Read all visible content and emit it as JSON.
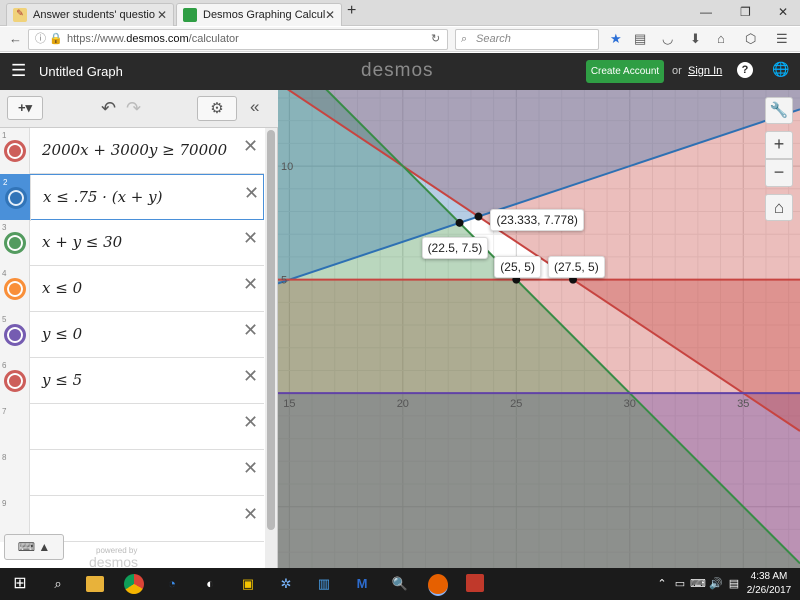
{
  "browser": {
    "tabs": [
      {
        "title": "Answer students' question…",
        "close": "✕"
      },
      {
        "title": "Desmos Graphing Calcula…",
        "close": "✕"
      }
    ],
    "new_tab": "+",
    "window_controls": [
      "—",
      "❐",
      "✕"
    ],
    "url_prefix": "https://www.",
    "url_domain": "desmos.com",
    "url_path": "/calculator",
    "search_placeholder": "Search",
    "reload": "↻"
  },
  "desmos": {
    "menu_icon": "☰",
    "graph_title": "Untitled Graph",
    "logo": "desmos",
    "create_account": "Create Account",
    "or": "or",
    "sign_in": "Sign In",
    "help": "?",
    "globe": "🌐"
  },
  "expression_toolbar": {
    "add": "+▾",
    "undo": "↶",
    "redo": "↷",
    "settings": "⚙",
    "collapse": "«"
  },
  "expressions": [
    {
      "num": "1",
      "text": "2000x + 3000y ≥ 70000",
      "color": "#c74440"
    },
    {
      "num": "2",
      "text": "x ≤ .75 · (x + y)",
      "color": "#2d70b3"
    },
    {
      "num": "3",
      "text": "x + y ≤ 30",
      "color": "#388c46"
    },
    {
      "num": "4",
      "text": "x ≤ 0",
      "color": "#fa7e19"
    },
    {
      "num": "5",
      "text": "y ≤ 0",
      "color": "#6042a6"
    },
    {
      "num": "6",
      "text": "y ≤ 5",
      "color": "#c74440"
    },
    {
      "num": "7",
      "text": "",
      "color": ""
    },
    {
      "num": "8",
      "text": "",
      "color": ""
    },
    {
      "num": "9",
      "text": "",
      "color": ""
    }
  ],
  "keyboard_toggle": "⌨ ▲",
  "powered_by": "powered by",
  "powered_logo": "desmos",
  "graph": {
    "x_ticks": [
      "15",
      "20",
      "25",
      "30",
      "35"
    ],
    "y_ticks": [
      "10",
      "5"
    ],
    "points": [
      {
        "label": "(23.333, 7.778)"
      },
      {
        "label": "(22.5, 7.5)"
      },
      {
        "label": "(25, 5)"
      },
      {
        "label": "(27.5, 5)"
      }
    ],
    "tools": {
      "wrench": "🔧",
      "zoom_in": "+",
      "zoom_out": "−",
      "home": "⌂"
    }
  },
  "taskbar": {
    "start": "⊞",
    "time": "4:38 AM",
    "date": "2/26/2017"
  }
}
